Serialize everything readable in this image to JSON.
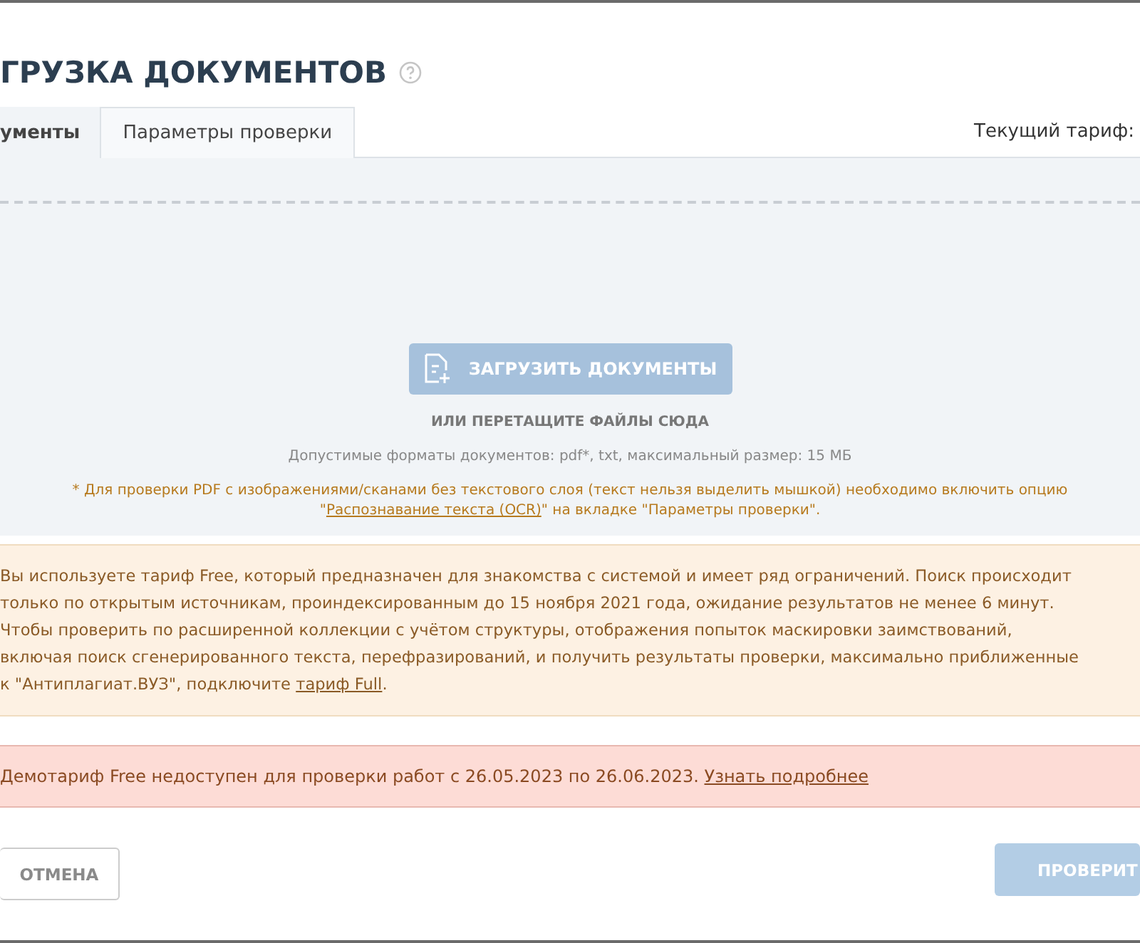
{
  "title": "ГРУЗКА ДОКУМЕНТОВ",
  "tabs": [
    {
      "label": "ументы",
      "selected": true
    },
    {
      "label": "Параметры проверки",
      "selected": false
    }
  ],
  "current_plan_label": "Текущий тариф:",
  "upload": {
    "button": "ЗАГРУЗИТЬ ДОКУМЕНТЫ",
    "drop_hint": "ИЛИ ПЕРЕТАЩИТЕ ФАЙЛЫ СЮДА",
    "formats": "Допустимые форматы документов: pdf*, txt, максимальный размер: 15 МБ",
    "note_before": "* Для проверки PDF с изображениями/сканами без текстового слоя (текст нельзя выделить мышкой) необходимо включить опцию\n\"",
    "note_link": "Распознавание текста (OCR)",
    "note_after": "\" на вкладке \"Параметры проверки\"."
  },
  "info": {
    "text": "Вы используете тариф Free, который предназначен для знакомства с системой и имеет ряд ограничений. Поиск происходит\nтолько по открытым источникам, проиндексированным до 15 ноября 2021 года, ожидание результатов не менее 6 минут.\nЧтобы проверить по расширенной коллекции с учётом структуры, отображения попыток маскировки заимствований,\nвключая поиск сгенерированного текста, перефразирований, и получить результаты проверки, максимально приближенные\nк \"Антиплагиат.ВУЗ\", подключите ",
    "link": "тариф Full",
    "after": "."
  },
  "alert": {
    "text": "Демотариф Free недоступен для проверки работ с 26.05.2023 по 26.06.2023. ",
    "link": "Узнать подробнее"
  },
  "buttons": [
    {
      "label": "ОТМЕНА",
      "kind": "secondary"
    },
    {
      "label": "ПРОВЕРИТ",
      "kind": "primary"
    }
  ]
}
